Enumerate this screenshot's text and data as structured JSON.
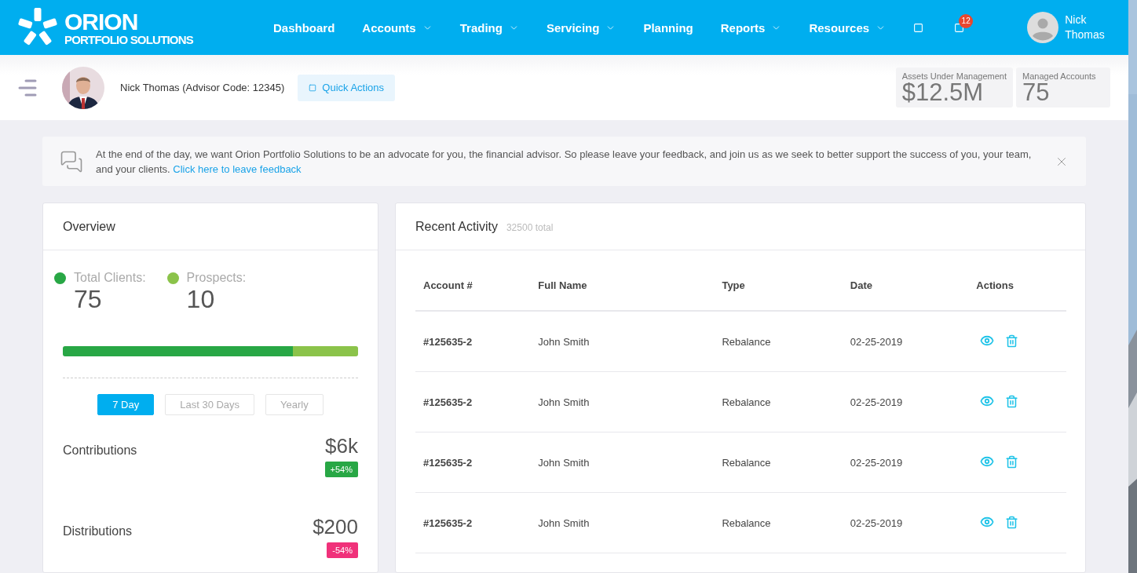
{
  "brand": {
    "name": "ORION",
    "tagline": "PORTFOLIO SOLUTIONS"
  },
  "nav": [
    {
      "label": "Dashboard",
      "dropdown": false
    },
    {
      "label": "Accounts",
      "dropdown": true
    },
    {
      "label": "Trading",
      "dropdown": true
    },
    {
      "label": "Servicing",
      "dropdown": true
    },
    {
      "label": "Planning",
      "dropdown": false
    },
    {
      "label": "Reports",
      "dropdown": true
    },
    {
      "label": "Resources",
      "dropdown": true
    }
  ],
  "notifications": {
    "count": "12"
  },
  "user": {
    "first": "Nick",
    "last": "Thomas"
  },
  "advisor": {
    "name": "Nick Thomas (Advisor Code: 12345)",
    "quick_actions": "Quick Actions"
  },
  "stats": [
    {
      "label": "Assets Under Management",
      "value": "$12.5M"
    },
    {
      "label": "Managed Accounts",
      "value": "75"
    }
  ],
  "feedback": {
    "text": "At the end of the day, we want Orion Portfolio Solutions to be an advocate for you, the financial advisor. So please leave your feedback, and join us as we seek to better support the success of you, your team, and your clients.",
    "link": "Click here to leave feedback"
  },
  "overview": {
    "title": "Overview",
    "counts": [
      {
        "label": "Total Clients:",
        "value": "75",
        "color": "#28a745",
        "level": 0.78
      },
      {
        "label": "Prospects:",
        "value": "10",
        "color": "#8bc34a",
        "level": 0.22
      }
    ],
    "periods": [
      {
        "label": "7 Day",
        "selected": true
      },
      {
        "label": "Last 30 Days",
        "selected": false
      },
      {
        "label": "Yearly",
        "selected": false
      }
    ],
    "metrics": [
      {
        "label": "Contributions",
        "value": "$6k",
        "change": "+54%",
        "color": "#28a745"
      },
      {
        "label": "Distributions",
        "value": "$200",
        "change": "-54%",
        "color": "#f0317a"
      }
    ]
  },
  "activity": {
    "title": "Recent Activity",
    "total": "32500 total",
    "columns": [
      "Account #",
      "Full Name",
      "Type",
      "Date",
      "Actions"
    ],
    "rows": [
      {
        "account": "#125635-2",
        "name": "John Smith",
        "type": "Rebalance",
        "date": "02-25-2019"
      },
      {
        "account": "#125635-2",
        "name": "John Smith",
        "type": "Rebalance",
        "date": "02-25-2019"
      },
      {
        "account": "#125635-2",
        "name": "John Smith",
        "type": "Rebalance",
        "date": "02-25-2019"
      },
      {
        "account": "#125635-2",
        "name": "John Smith",
        "type": "Rebalance",
        "date": "02-25-2019"
      }
    ]
  }
}
